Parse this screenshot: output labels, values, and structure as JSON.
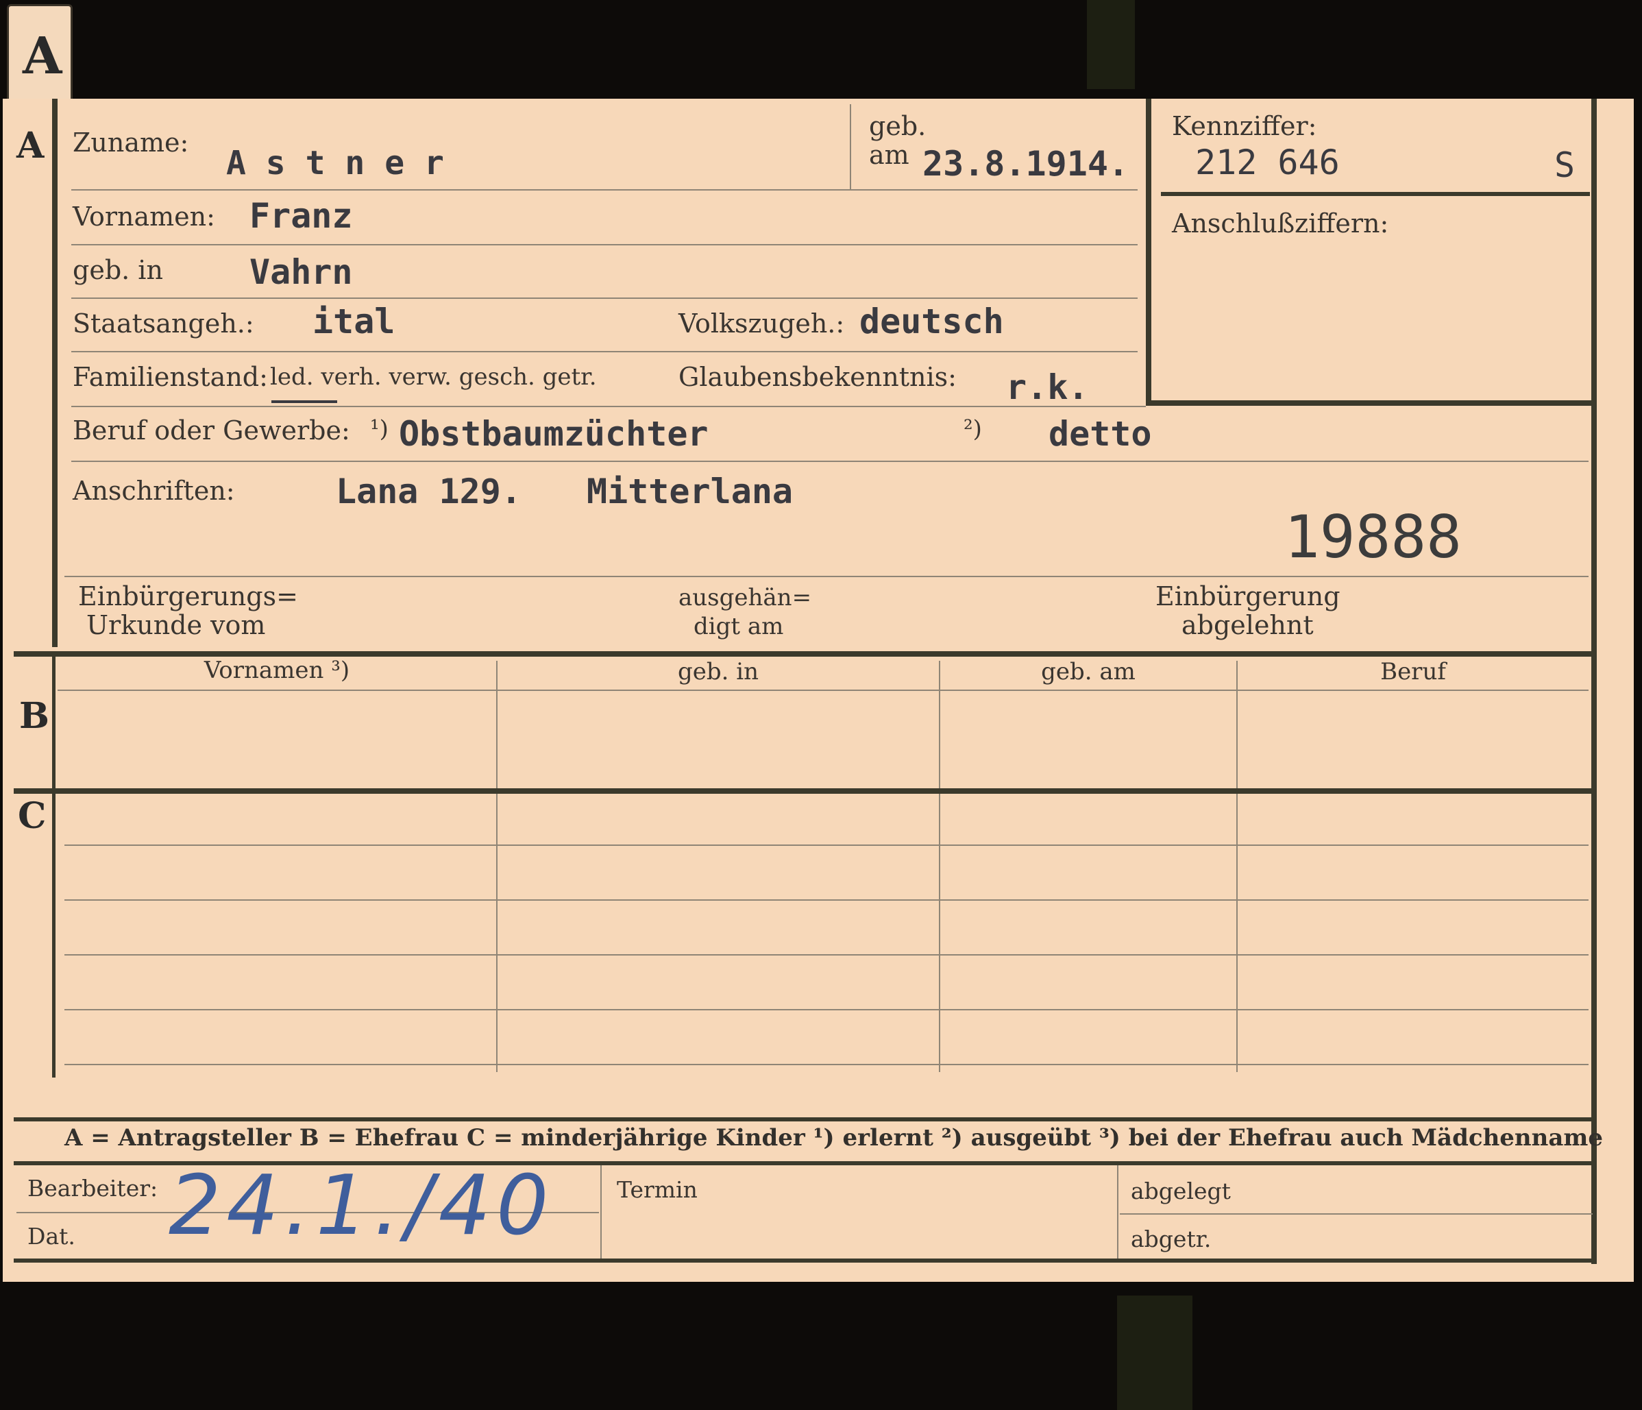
{
  "tab_letter": "A",
  "section_a": {
    "letter": "A",
    "zuname_label": "Zuname:",
    "zuname_value": "A s t n e r",
    "geb_label": "geb.",
    "am_label": "am",
    "birth_date": "23.8.1914.",
    "kennziffer_label": "Kennziffer:",
    "kennziffer_value": "212 646",
    "kennziffer_suffix": "S",
    "anschluss_label": "Anschlußziffern:",
    "vornamen_label": "Vornamen:",
    "vornamen_value": "Franz",
    "geb_in_label": "geb. in",
    "geb_in_value": "Vahrn",
    "staatsangeh_label": "Staatsangeh.:",
    "staatsangeh_value": "ital",
    "volkszugeh_label": "Volkszugeh.:",
    "volkszugeh_value": "deutsch",
    "familienstand_label": "Familienstand:",
    "familienstand_options": "led. verh. verw. gesch. getr.",
    "glauben_label": "Glaubensbekenntnis:",
    "glauben_value": "r.k.",
    "beruf_label": "Beruf oder Gewerbe:",
    "beruf_note1": "¹)",
    "beruf_value1": "Obstbaumzüchter",
    "beruf_note2": "²)",
    "beruf_value2": "detto",
    "anschriften_label": "Anschriften:",
    "anschrift_1": "Lana 129.",
    "anschrift_2": "Mitterlana",
    "stamp_number": "19888",
    "einbuergerung_urkunde_l1": "Einbürgerungs=",
    "einbuergerung_urkunde_l2": "Urkunde vom",
    "ausgehaendigt_l1": "ausgehän=",
    "ausgehaendigt_l2": "digt am",
    "einbuergerung_abgelehnt_l1": "Einbürgerung",
    "einbuergerung_abgelehnt_l2": "abgelehnt"
  },
  "section_b": {
    "letter": "B",
    "columns": [
      "Vornamen ³)",
      "geb. in",
      "geb. am",
      "Beruf"
    ]
  },
  "section_c": {
    "letter": "C"
  },
  "legend": "A = Antragsteller   B = Ehefrau   C = minderjährige Kinder   ¹) erlernt   ²) ausgeübt   ³) bei der Ehefrau auch Mädchenname",
  "footer": {
    "bearbeiter_label": "Bearbeiter:",
    "dat_label": "Dat.",
    "date_handwritten": "24.1./40",
    "termin_label": "Termin",
    "abgelegt_label": "abgelegt",
    "abgetr_label": "abgetr."
  }
}
